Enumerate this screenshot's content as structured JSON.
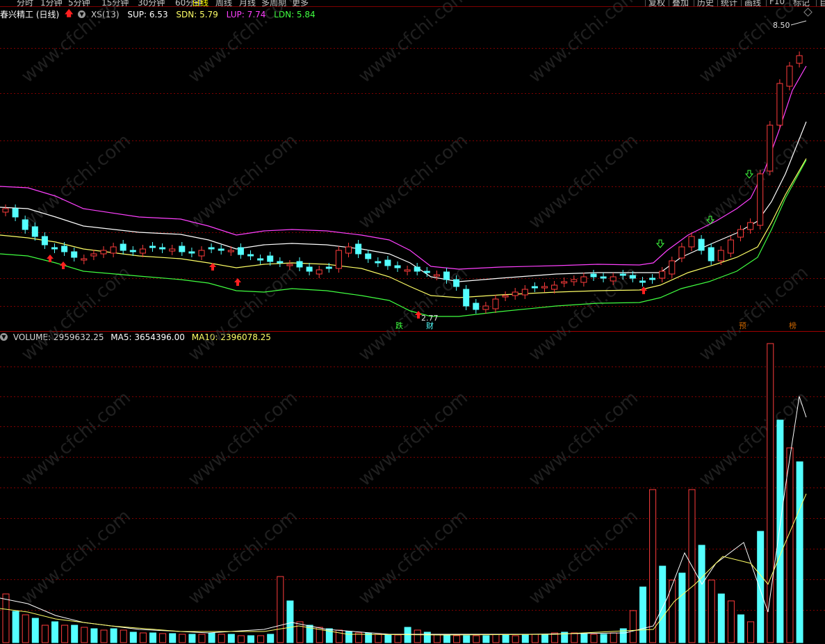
{
  "toolbar": {
    "periods": [
      "分时",
      "1分钟",
      "5分钟",
      "15分钟",
      "30分钟",
      "60分钟",
      "日线",
      "周线",
      "月线",
      "多周期",
      "更多"
    ],
    "active_period": "日线",
    "tools": [
      "复权",
      "叠加",
      "历史",
      "统计",
      "画线",
      "F10",
      "标记"
    ],
    "tools_right_partial": "自"
  },
  "main": {
    "stock_name": "春兴精工",
    "period_label": "(日线)",
    "indicator": "XS(13)",
    "sup": "SUP: 6.53",
    "sdn": "SDN: 5.79",
    "lup": "LUP: 7.74",
    "ldn": "LDN: 5.84",
    "high_label": "8.50",
    "low_label": "2.77",
    "markers": [
      "跌",
      "财",
      "预",
      "榜"
    ]
  },
  "volume": {
    "label": "VOLUME: 2959632.25",
    "ma5": "MA5: 3654396.00",
    "ma10": "MA10: 2396078.25"
  },
  "colors": {
    "up": "#ff3c3c",
    "down": "#54ffff",
    "lup": "#ff40ff",
    "sup": "#ffffff",
    "sdn": "#ffff66",
    "ldn": "#40ff40",
    "grid": "#800000",
    "watermark": "#3a3a3a"
  },
  "watermark": "www.cfchi.com"
}
